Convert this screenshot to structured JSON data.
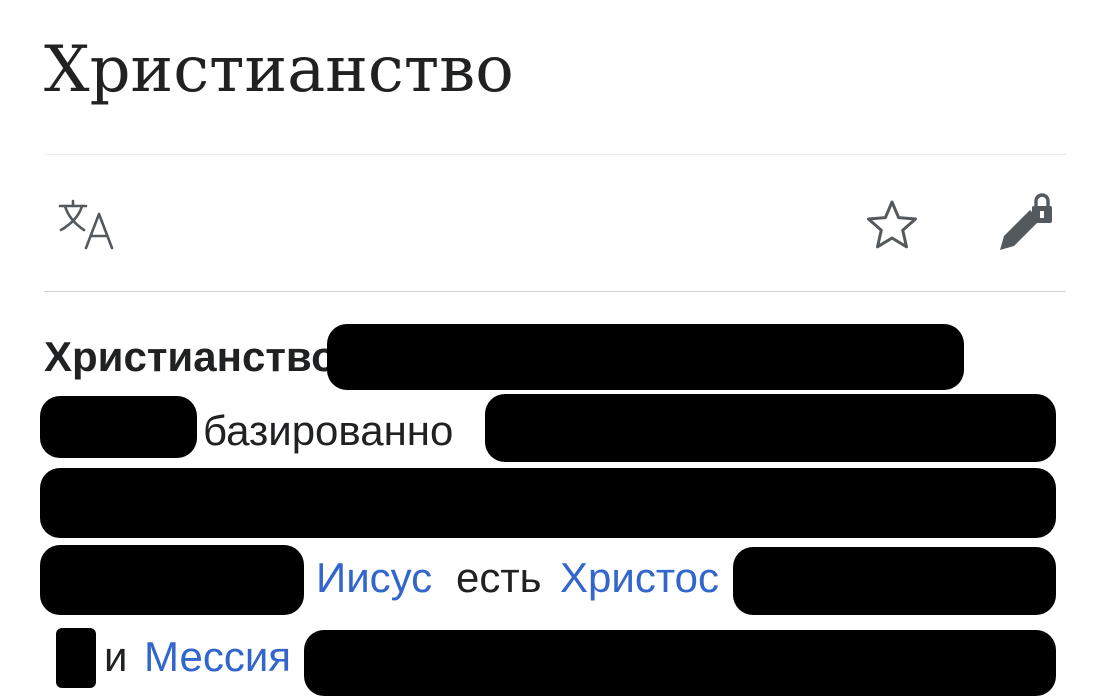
{
  "article": {
    "title": "Христианство"
  },
  "toolbar": {
    "language_icon": "translate-icon",
    "watch_icon": "star-icon",
    "edit_icon": "edit-lock-icon"
  },
  "lead": {
    "subject": "Христианство",
    "word_based": "базированно",
    "link_jesus": "Иисус",
    "word_is": "есть",
    "link_christ": "Христос",
    "word_and": "и",
    "link_messiah": "Мессия"
  },
  "colors": {
    "link": "#3366cc",
    "text": "#202122",
    "redaction": "#000000"
  }
}
